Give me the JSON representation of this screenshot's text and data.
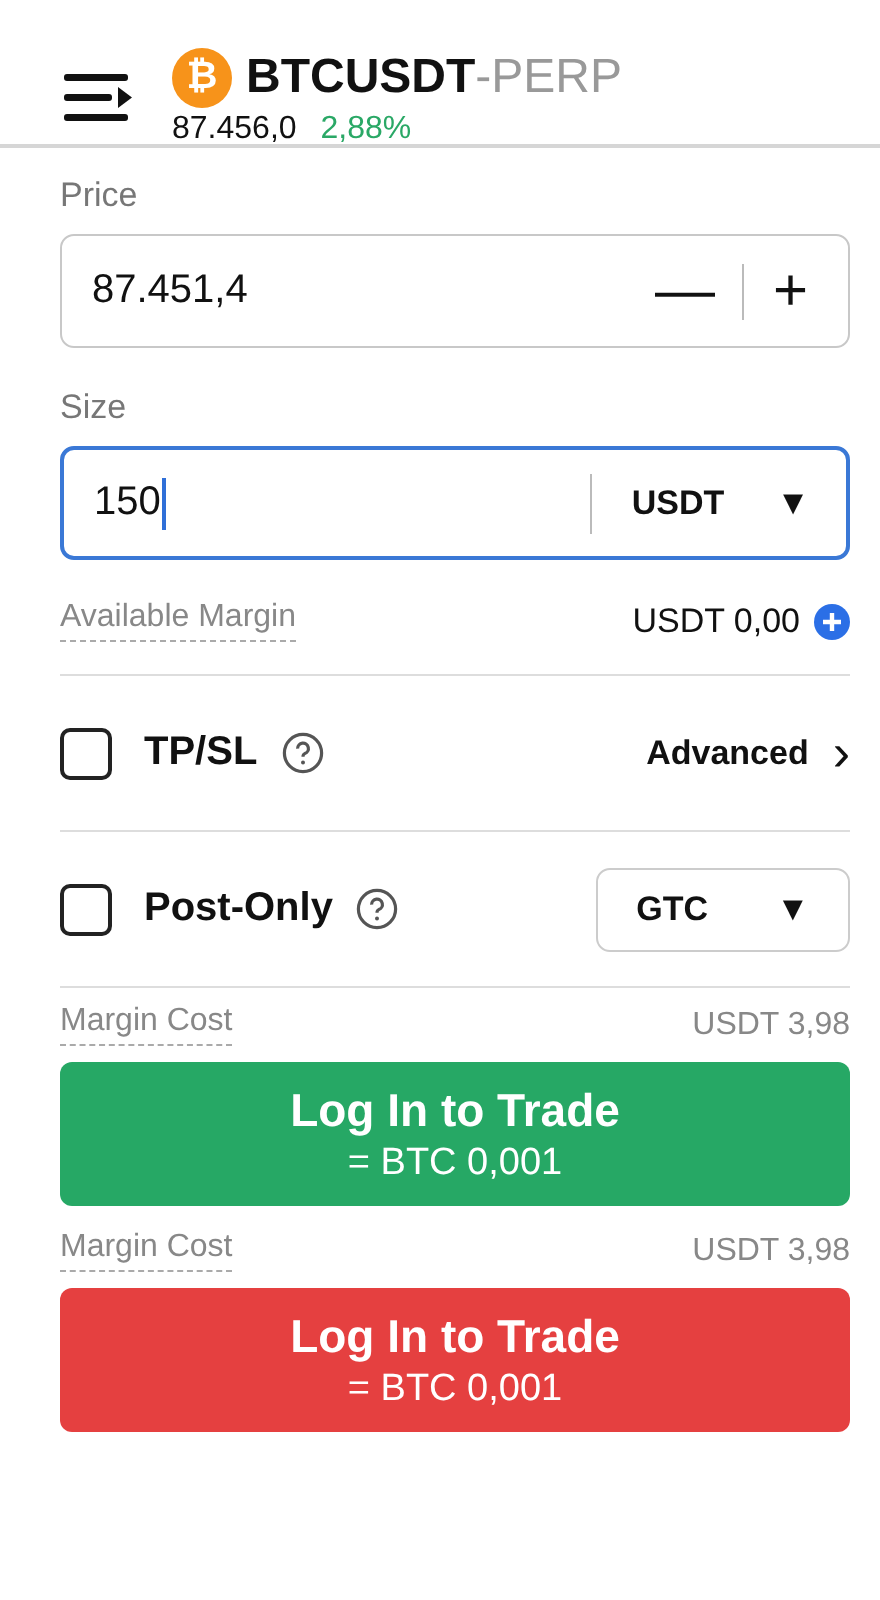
{
  "header": {
    "coin_symbol": "₿",
    "symbol": "BTCUSDT",
    "suffix": "-PERP",
    "last_price": "87.456,0",
    "change": "2,88%"
  },
  "price": {
    "label": "Price",
    "value": "87.451,4",
    "minus": "—",
    "plus": "+"
  },
  "size": {
    "label": "Size",
    "value": "150",
    "focused": true,
    "unit": "USDT",
    "unit_caret": "▼"
  },
  "available_margin": {
    "label": "Available Margin",
    "value": "USDT 0,00"
  },
  "options": [
    {
      "kind": "link",
      "label": "TP/SL",
      "checked": false,
      "action": "Advanced",
      "action_icon": "›"
    },
    {
      "kind": "select",
      "label": "Post-Only",
      "checked": false,
      "action": "GTC",
      "action_icon": "▼"
    }
  ],
  "orders": [
    {
      "color": "#26a865",
      "cost_label": "Margin Cost",
      "cost_value": "USDT 3,98",
      "button_title": "Log In to Trade",
      "button_sub": "= BTC 0,001"
    },
    {
      "color": "#e54040",
      "cost_label": "Margin Cost",
      "cost_value": "USDT 3,98",
      "button_title": "Log In to Trade",
      "button_sub": "= BTC 0,001"
    }
  ]
}
